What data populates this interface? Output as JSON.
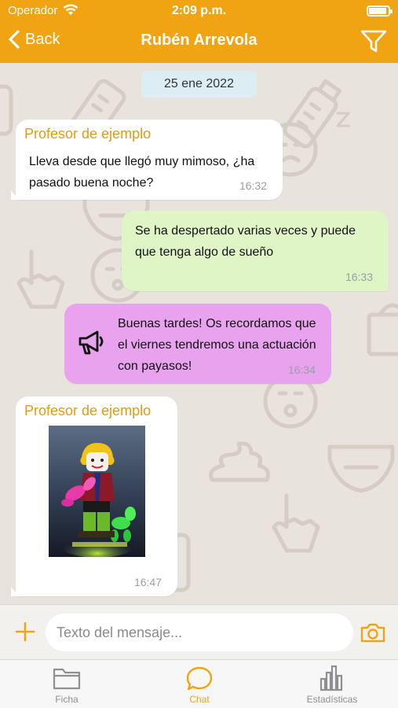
{
  "status_bar": {
    "carrier": "Operador",
    "time": "2:09 p.m.",
    "battery_level": 0.9
  },
  "nav": {
    "back_label": "Back",
    "title": "Rubén Arrevola"
  },
  "chat": {
    "date_separator": "25 ene 2022",
    "messages": [
      {
        "sender": "Profesor de ejemplo",
        "text": "Lleva desde que llegó muy mimoso, ¿ha pasado buena noche?",
        "time": "16:32"
      },
      {
        "text": "Se ha despertado varias veces y puede que tenga algo de sueño",
        "time": "16:33"
      },
      {
        "icon": "megaphone-icon",
        "text": "Buenas tardes! Os recordamos que el viernes tendremos una actuación con payasos!",
        "time": "16:34"
      },
      {
        "sender": "Profesor de ejemplo",
        "image": "clown-toy-photo",
        "time": "16:47"
      }
    ]
  },
  "input": {
    "placeholder": "Texto del mensaje..."
  },
  "tabs": [
    {
      "label": "Ficha",
      "icon": "folder-icon"
    },
    {
      "label": "Chat",
      "icon": "chat-bubble-icon",
      "active": true
    },
    {
      "label": "Estadísticas",
      "icon": "bar-chart-icon"
    }
  ],
  "colors": {
    "accent": "#f0a412",
    "outgoing": "#dff5c6",
    "announcement": "#e8a2ee",
    "date_chip": "#dcedf4"
  }
}
